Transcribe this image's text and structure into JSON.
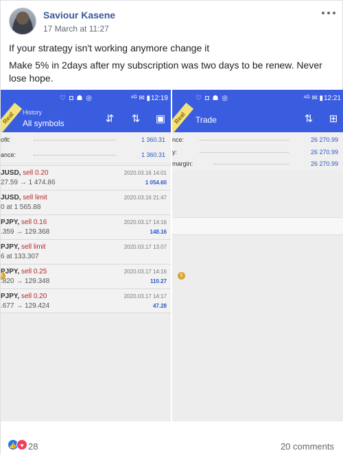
{
  "post": {
    "author": "Saviour Kasene",
    "timestamp": "17 March at 11:27",
    "line1": "If your strategy isn't working anymore change it",
    "line2": "Make 5% in 2days after my subscription was two days to be renew. Never lose hope.",
    "reaction_count": "28",
    "comments": "20 comments"
  },
  "left_screen": {
    "status_time": "12:19",
    "status_icons": "♡ ◘ ☗ ◎",
    "status_right_icons": "⁴ᴳ ✉ ▮",
    "ribbon": "Real",
    "subtitle": "History",
    "title": "All symbols",
    "summary": [
      {
        "label": "ofit:",
        "value": "1 360.31"
      },
      {
        "label": "ance:",
        "value": "1 360.31"
      }
    ],
    "trades": [
      {
        "symbol": "JUSD, ",
        "type": "sell 0.20",
        "price": "27.59 → 1 474.86",
        "date": "2020.03.16 14:01",
        "profit": "1 054.60"
      },
      {
        "symbol": "JUSD, ",
        "type": "sell limit",
        "price": "0 at 1 565.88",
        "date": "2020.03.16 21:47",
        "profit": ""
      },
      {
        "symbol": "PJPY, ",
        "type": "sell 0.16",
        "price": ".359 → 129.368",
        "date": "2020.03.17 14:16",
        "profit": "148.16"
      },
      {
        "symbol": "PJPY, ",
        "type": "sell limit",
        "price": "6 at 133.307",
        "date": "2020.03.17 13:07",
        "profit": ""
      },
      {
        "symbol": "PJPY, ",
        "type": "sell 0.25",
        "price": ".820 → 129.348",
        "date": "2020.03.17 14:16",
        "profit": "110.27"
      },
      {
        "symbol": "PJPY, ",
        "type": "sell 0.20",
        "price": ".677 → 129.424",
        "date": "2020.03.17 14:17",
        "profit": "47.28"
      }
    ]
  },
  "right_screen": {
    "status_time": "12:21",
    "status_icons": "♡ ◘ ☗ ◎",
    "status_right_icons": "⁴ᴳ ✉ ▮",
    "ribbon": "Real",
    "title": "Trade",
    "summary": [
      {
        "label": "nce:",
        "value": "26 270.99"
      },
      {
        "label": "y:",
        "value": "26 270.99"
      },
      {
        "label": "margin:",
        "value": "26 270.99"
      }
    ]
  },
  "badge_label": "5"
}
